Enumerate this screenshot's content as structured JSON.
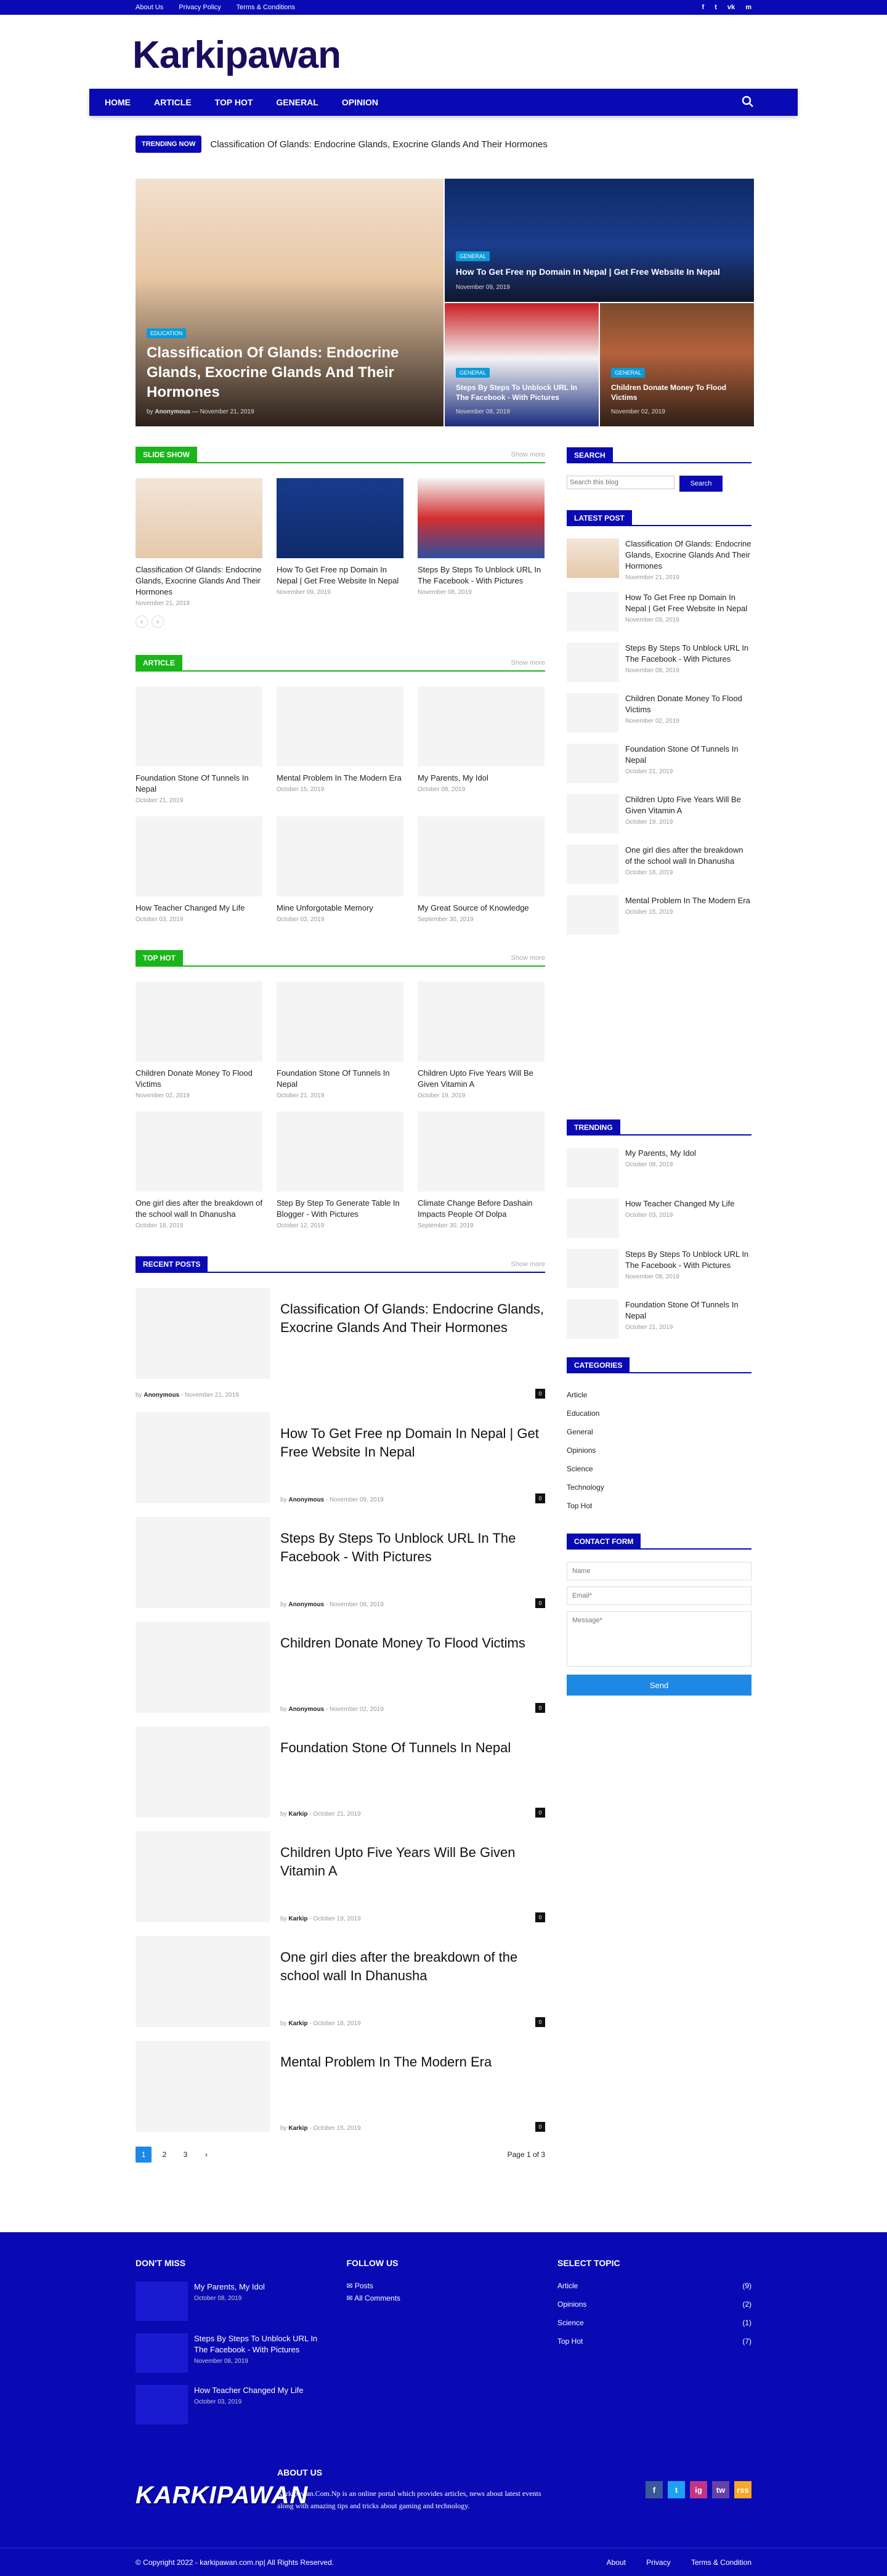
{
  "topbar": {
    "links": [
      "About Us",
      "Privacy Policy",
      "Terms & Conditions"
    ],
    "social": [
      "f",
      "t",
      "vk",
      "m"
    ]
  },
  "site": {
    "logo": "Karkipawan"
  },
  "nav": {
    "items": [
      "HOME",
      "ARTICLE",
      "TOP HOT",
      "GENERAL",
      "OPINION"
    ]
  },
  "trending": {
    "badge": "TRENDING NOW",
    "text": "Classification Of Glands: Endocrine Glands, Exocrine Glands And Their Hormones"
  },
  "hero": {
    "big": {
      "category": "EDUCATION",
      "title": "Classification Of Glands: Endocrine Glands, Exocrine Glands And Their Hormones",
      "by": "by",
      "author": "Anonymous",
      "date": "November 21, 2019"
    },
    "c2": {
      "category": "GENERAL",
      "title": "How To Get Free np Domain In Nepal | Get Free Website In Nepal",
      "date": "November 09, 2019"
    },
    "c3": {
      "category": "GENERAL",
      "title": "Steps By Steps To Unblock URL In The Facebook - With Pictures",
      "date": "November 08, 2019"
    },
    "c4": {
      "category": "GENERAL",
      "title": "Children Donate Money To Flood Victims",
      "date": "November 02, 2019"
    }
  },
  "slideshow": {
    "title": "SLIDE SHOW",
    "more": "Show more",
    "items": [
      {
        "title": "Classification Of Glands: Endocrine Glands, Exocrine Glands And Their Hormones",
        "date": "November 21, 2019"
      },
      {
        "title": "How To Get Free np Domain In Nepal | Get Free Website In Nepal",
        "date": "November 09, 2019"
      },
      {
        "title": "Steps By Steps To Unblock URL In The Facebook - With Pictures",
        "date": "November 08, 2019"
      }
    ]
  },
  "article": {
    "title": "ARTICLE",
    "more": "Show more",
    "items": [
      {
        "title": "Foundation Stone Of Tunnels In Nepal",
        "date": "October 21, 2019"
      },
      {
        "title": "Mental Problem In The Modern Era",
        "date": "October 15, 2019"
      },
      {
        "title": "My Parents, My Idol",
        "date": "October 08, 2019"
      },
      {
        "title": "How Teacher Changed My Life",
        "date": "October 03, 2019"
      },
      {
        "title": "Mine Unforgotable Memory",
        "date": "October 03, 2019"
      },
      {
        "title": "My Great Source of Knowledge",
        "date": "September 30, 2019"
      }
    ]
  },
  "tophot": {
    "title": "TOP HOT",
    "more": "Show more",
    "items": [
      {
        "title": "Children Donate Money To Flood Victims",
        "date": "November 02, 2019"
      },
      {
        "title": "Foundation Stone Of Tunnels In Nepal",
        "date": "October 21, 2019"
      },
      {
        "title": "Children Upto Five Years Will Be Given Vitamin A",
        "date": "October 19, 2019"
      },
      {
        "title": "One girl dies after the breakdown of the school wall In Dhanusha",
        "date": "October 18, 2019"
      },
      {
        "title": "Step By Step To Generate Table In Blogger - With Pictures",
        "date": "October 12, 2019"
      },
      {
        "title": "Climate Change Before Dashain Impacts People Of Dolpa",
        "date": "September 30, 2019"
      }
    ]
  },
  "recent": {
    "title": "RECENT POSTS",
    "more": "Show more",
    "by": "by",
    "items": [
      {
        "title": "Classification Of Glands: Endocrine Glands, Exocrine Glands And Their Hormones",
        "author": "Anonymous",
        "date": "November 21, 2019",
        "count": "0"
      },
      {
        "title": "How To Get Free np Domain In Nepal | Get Free Website In Nepal",
        "author": "Anonymous",
        "date": "November 09, 2019",
        "count": "0"
      },
      {
        "title": "Steps By Steps To Unblock URL In The Facebook - With Pictures",
        "author": "Anonymous",
        "date": "November 08, 2019",
        "count": "0"
      },
      {
        "title": "Children Donate Money To Flood Victims",
        "author": "Anonymous",
        "date": "November 02, 2019",
        "count": "0"
      },
      {
        "title": "Foundation Stone Of Tunnels In Nepal",
        "author": "Karkip",
        "date": "October 21, 2019",
        "count": "0"
      },
      {
        "title": "Children Upto Five Years Will Be Given Vitamin A",
        "author": "Karkip",
        "date": "October 19, 2019",
        "count": "0"
      },
      {
        "title": "One girl dies after the breakdown of the school wall In Dhanusha",
        "author": "Karkip",
        "date": "October 18, 2019",
        "count": "0"
      },
      {
        "title": "Mental Problem In The Modern Era",
        "author": "Karkip",
        "date": "October 15, 2019",
        "count": "0"
      }
    ],
    "pages": [
      "1",
      "2",
      "3",
      "›"
    ],
    "page_total": "Page 1 of 3"
  },
  "sidebar": {
    "search": {
      "title": "SEARCH",
      "placeholder": "Search this blog",
      "button": "Search"
    },
    "latest": {
      "title": "LATEST POST",
      "items": [
        {
          "title": "Classification Of Glands: Endocrine Glands, Exocrine Glands And Their Hormones",
          "date": "November 21, 2019"
        },
        {
          "title": "How To Get Free np Domain In Nepal | Get Free Website In Nepal",
          "date": "November 09, 2019"
        },
        {
          "title": "Steps By Steps To Unblock URL In The Facebook - With Pictures",
          "date": "November 08, 2019"
        },
        {
          "title": "Children Donate Money To Flood Victims",
          "date": "November 02, 2019"
        },
        {
          "title": "Foundation Stone Of Tunnels In Nepal",
          "date": "October 21, 2019"
        },
        {
          "title": "Children Upto Five Years Will Be Given Vitamin A",
          "date": "October 19, 2019"
        },
        {
          "title": "One girl dies after the breakdown of the school wall In Dhanusha",
          "date": "October 18, 2019"
        },
        {
          "title": "Mental Problem In The Modern Era",
          "date": "October 15, 2019"
        }
      ]
    },
    "trending": {
      "title": "TRENDING",
      "items": [
        {
          "title": "My Parents, My Idol",
          "date": "October 08, 2019"
        },
        {
          "title": "How Teacher Changed My Life",
          "date": "October 03, 2019"
        },
        {
          "title": "Steps By Steps To Unblock URL In The Facebook - With Pictures",
          "date": "November 08, 2019"
        },
        {
          "title": "Foundation Stone Of Tunnels In Nepal",
          "date": "October 21, 2019"
        }
      ]
    },
    "categories": {
      "title": "CATEGORIES",
      "items": [
        "Article",
        "Education",
        "General",
        "Opinions",
        "Science",
        "Technology",
        "Top Hot"
      ]
    },
    "contact": {
      "title": "CONTACT FORM",
      "name": "Name",
      "email": "Email*",
      "message": "Message*",
      "send": "Send"
    }
  },
  "footer": {
    "dontmiss": {
      "title": "DON'T MISS",
      "items": [
        {
          "title": "My Parents, My Idol",
          "date": "October 08, 2019"
        },
        {
          "title": "Steps By Steps To Unblock URL In The Facebook - With Pictures",
          "date": "November 08, 2019"
        },
        {
          "title": "How Teacher Changed My Life",
          "date": "October 03, 2019"
        }
      ]
    },
    "follow": {
      "title": "FOLLOW US",
      "items": [
        "Posts",
        "All Comments"
      ]
    },
    "topics": {
      "title": "SELECT TOPIC",
      "items": [
        {
          "name": "Article",
          "count": "(9)"
        },
        {
          "name": "Opinions",
          "count": "(2)"
        },
        {
          "name": "Science",
          "count": "(1)"
        },
        {
          "name": "Top Hot",
          "count": "(7)"
        }
      ]
    },
    "about": {
      "title": "ABOUT US",
      "logo": "KARKIPAWAN",
      "text": "Karkipawan.Com.Np is an online portal which provides articles, news about latest events along with amazing tips and tricks about gaming and technology."
    },
    "social": [
      "f",
      "t",
      "ig",
      "tw",
      "rss"
    ],
    "copyright": "© Copyright 2022 - karkipawan.com.np| All Rights Reserved.",
    "links": [
      "About",
      "Privacy",
      "Terms & Condition"
    ]
  },
  "colors": {
    "primary": "#0a0ab4",
    "accent": "#1ab51a",
    "badge": "#0a9bd8",
    "button": "#1e88e5"
  }
}
